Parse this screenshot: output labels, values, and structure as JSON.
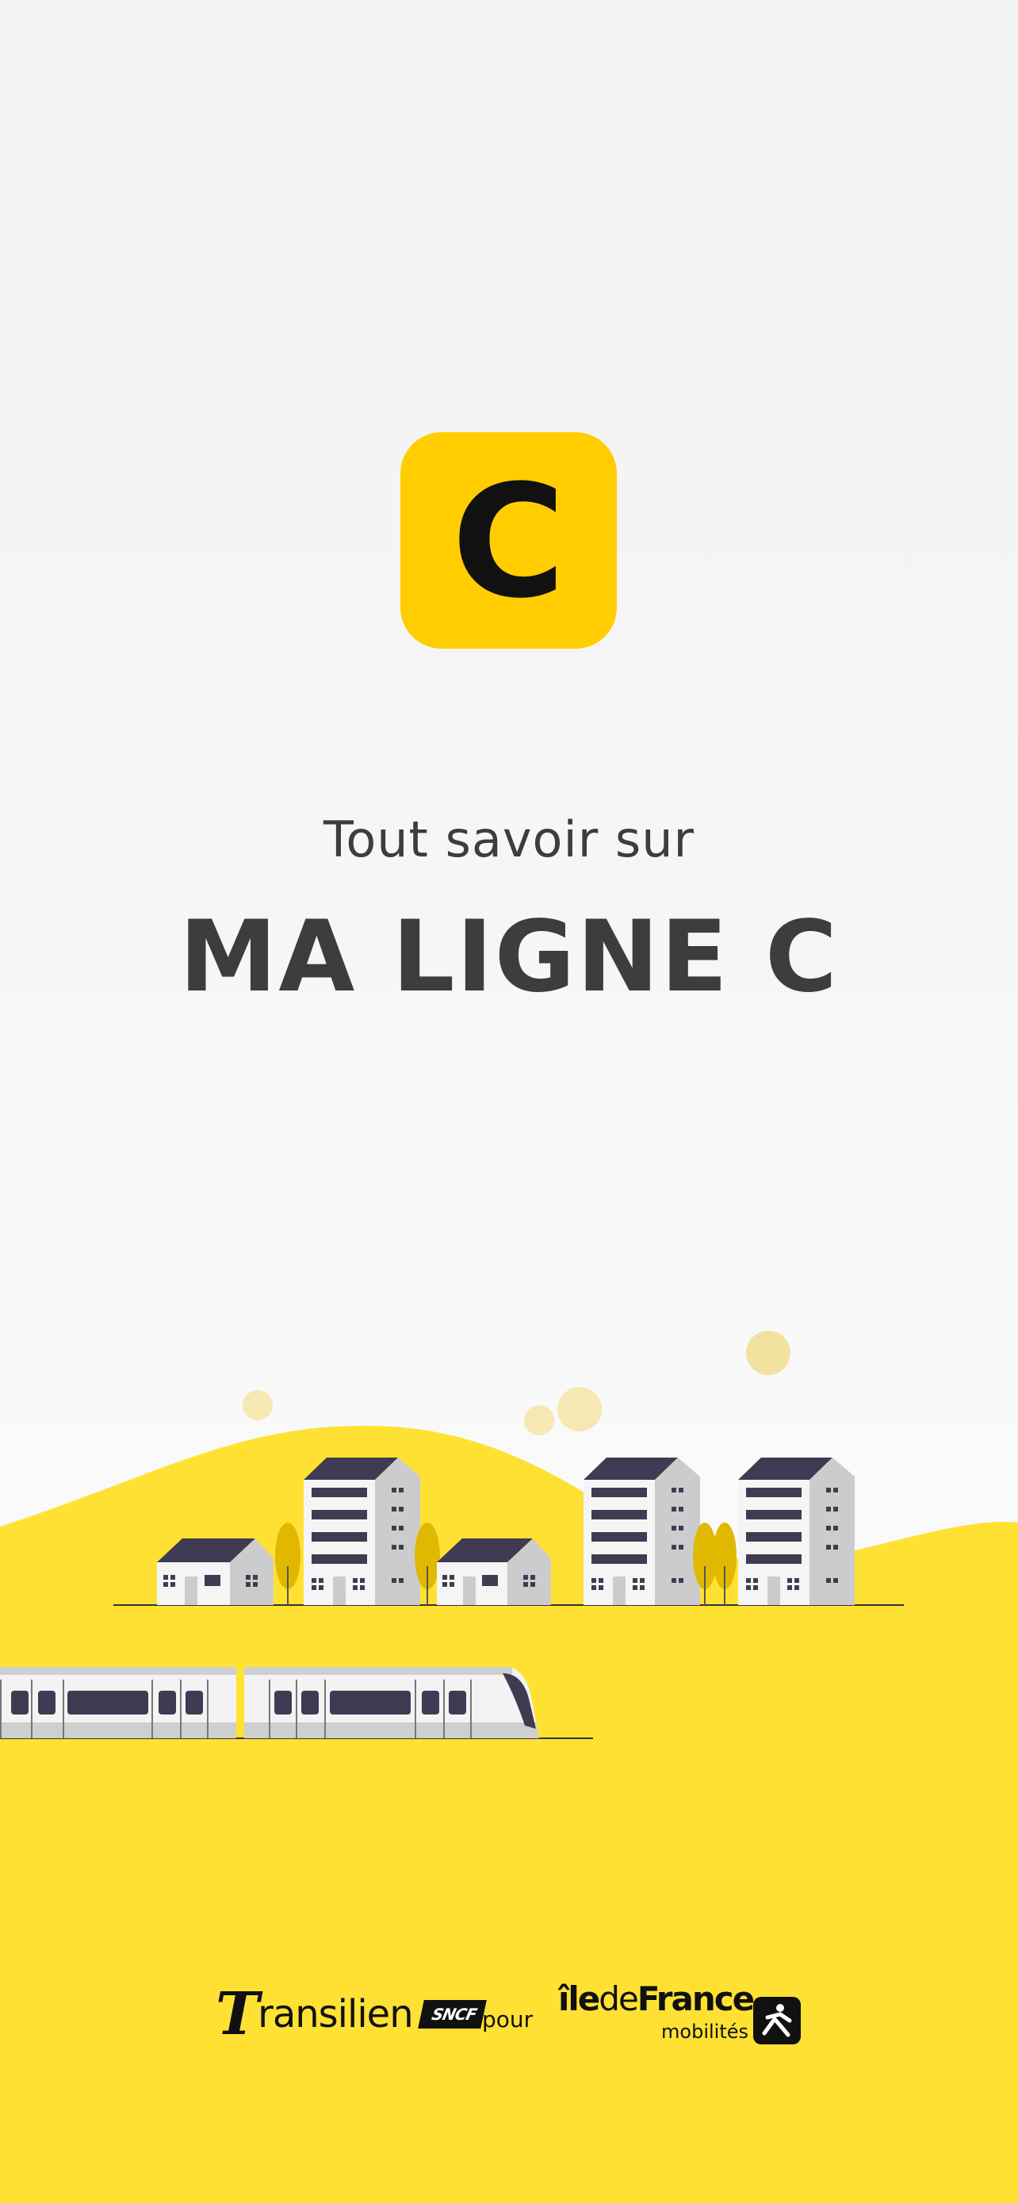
{
  "badge": {
    "letter": "C",
    "color": "#ffcd00"
  },
  "heading": {
    "subtitle": "Tout savoir sur",
    "title": "MA LIGNE C"
  },
  "colors": {
    "brand_yellow": "#ffe133",
    "badge_yellow": "#ffcd00",
    "text_dark": "#3d3d3d"
  },
  "illustration": {
    "name": "train-and-buildings-illustration"
  },
  "footer": {
    "transilien_t": "T",
    "transilien_word": "ransilien",
    "sncf": "SNCF",
    "pour": "pour",
    "idfm_ile": "île",
    "idfm_de": "de",
    "idfm_france": "France",
    "idfm_sub": "mobilités"
  }
}
